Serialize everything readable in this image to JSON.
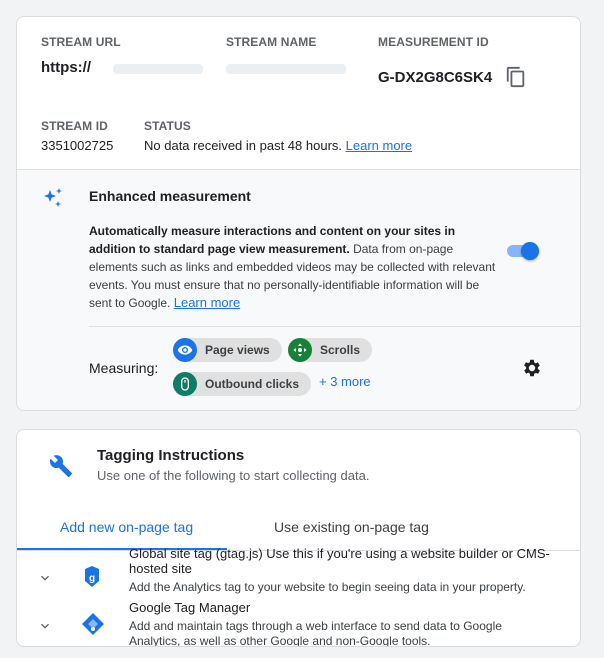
{
  "stream": {
    "url_label": "STREAM URL",
    "url_value": "https://",
    "name_label": "STREAM NAME",
    "measurement_id_label": "MEASUREMENT ID",
    "measurement_id": "G-DX2G8C6SK4",
    "stream_id_label": "STREAM ID",
    "stream_id": "3351002725",
    "status_label": "STATUS",
    "status_text": "No data received in past 48 hours.",
    "status_link": "Learn more"
  },
  "enhanced": {
    "title": "Enhanced measurement",
    "desc_bold": "Automatically measure interactions and content on your sites in addition to standard page view measurement.",
    "desc_text": "Data from on-page elements such as links and embedded videos may be collected with relevant events. You must ensure that no personally-identifiable information will be sent to Google.",
    "desc_link": "Learn more",
    "toggle_on": true,
    "measuring_label": "Measuring:",
    "chips": [
      {
        "label": "Page views",
        "icon": "eye-icon",
        "color": "#1a73e8"
      },
      {
        "label": "Scrolls",
        "icon": "scroll-crosshair-icon",
        "color": "#188038"
      },
      {
        "label": "Outbound clicks",
        "icon": "mouse-icon",
        "color": "#0e7c66"
      }
    ],
    "more": "+ 3 more"
  },
  "tagging": {
    "title": "Tagging Instructions",
    "subtitle": "Use one of the following to start collecting data.",
    "tabs": [
      "Add new on-page tag",
      "Use existing on-page tag"
    ],
    "rows": [
      {
        "title": "Global site tag (gtag.js) Use this if you're using a website builder or CMS-hosted site",
        "desc": "Add the Analytics tag to your website to begin seeing data in your property.",
        "icon": "gtag-icon"
      },
      {
        "title": "Google Tag Manager",
        "desc": "Add and maintain tags through a web interface to send data to Google Analytics, as well as other Google and non-Google tools.",
        "icon": "tag-manager-icon"
      }
    ]
  },
  "colors": {
    "accent": "#1a73e8",
    "toggle_track": "#8ab4f8"
  }
}
